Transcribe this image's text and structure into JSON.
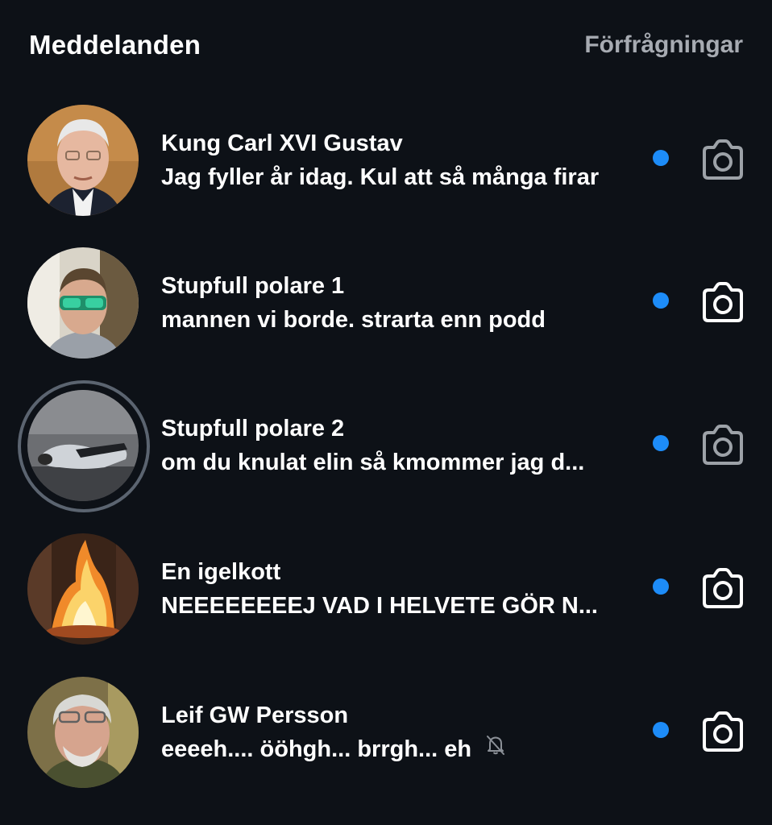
{
  "header": {
    "title": "Meddelanden",
    "requests_label": "Förfrågningar"
  },
  "threads": [
    {
      "name": "Kung Carl XVI Gustav",
      "preview": "Jag fyller år idag. Kul att så många firar",
      "unread": true,
      "has_story": false,
      "muted": false,
      "camera_dim": true
    },
    {
      "name": "Stupfull polare 1",
      "preview": "mannen vi borde. strarta enn podd",
      "unread": true,
      "has_story": false,
      "muted": false,
      "camera_dim": false
    },
    {
      "name": "Stupfull polare 2",
      "preview": "om du knulat  elin så kmommer jag d...",
      "unread": true,
      "has_story": true,
      "muted": false,
      "camera_dim": true
    },
    {
      "name": "En igelkott",
      "preview": "NEEEEEEEEJ VAD I HELVETE GÖR N...",
      "unread": true,
      "has_story": false,
      "muted": false,
      "camera_dim": false
    },
    {
      "name": "Leif GW Persson",
      "preview": "eeeeh.... ööhgh... brrgh... eh",
      "unread": true,
      "has_story": false,
      "muted": true,
      "camera_dim": false
    }
  ],
  "colors": {
    "background": "#0d1117",
    "text": "#ffffff",
    "secondary_text": "#a7abb2",
    "unread_dot": "#1d8cf8",
    "story_ring": "#5b6470"
  },
  "icons": {
    "camera": "camera-icon",
    "muted": "bell-slash-icon"
  }
}
